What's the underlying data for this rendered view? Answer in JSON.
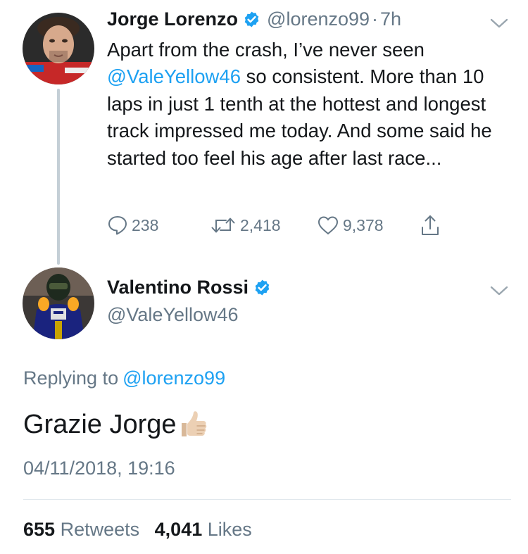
{
  "tweet1": {
    "display_name": "Jorge Lorenzo",
    "handle": "@lorenzo99",
    "separator": "·",
    "time_ago": "7h",
    "text_part1": "Apart from the crash, I’ve never seen ",
    "text_mention": "@ValeYellow46",
    "text_part2": " so consistent. More than 10 laps in just 1 tenth at the hottest and longest track impressed me today. And some said he started too feel his age after last race...",
    "reply_count": "238",
    "retweet_count": "2,418",
    "like_count": "9,378",
    "avatar_icon": "person-avatar",
    "verified_icon": "verified-badge",
    "caret_icon": "chevron-down-icon"
  },
  "tweet2": {
    "display_name": "Valentino Rossi",
    "handle": "@ValeYellow46",
    "replying_label": "Replying to",
    "replying_to": "@lorenzo99",
    "text": "Grazie Jorge",
    "emoji": "thumbs-up",
    "timestamp": "04/11/2018, 19:16",
    "retweets_count": "655",
    "retweets_label": "Retweets",
    "likes_count": "4,041",
    "likes_label": "Likes"
  },
  "colors": {
    "accent": "#1da1f2",
    "secondary_text": "#657786",
    "primary_text": "#14171a",
    "thread_line": "#c4cfd6"
  }
}
